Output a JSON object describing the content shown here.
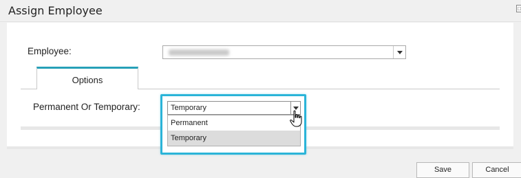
{
  "dialog": {
    "title": "Assign Employee"
  },
  "form": {
    "employee_label": "Employee:",
    "employee_value_redacted": true,
    "tab_label": "Options",
    "perm_temp_label": "Permanent Or Temporary:",
    "perm_temp_selected": "Temporary",
    "perm_temp_options": [
      "Permanent",
      "Temporary"
    ],
    "highlighted_option": "Temporary"
  },
  "footer": {
    "save_label": "Save",
    "cancel_label": "Cancel"
  },
  "colors": {
    "tab_accent": "#27a0b8",
    "highlight_border": "#2bb4d8",
    "hovered_option_bg": "#dcdcdc"
  },
  "icons": [
    "maximize-icon",
    "caret-down-icon",
    "hand-pointer-icon"
  ]
}
